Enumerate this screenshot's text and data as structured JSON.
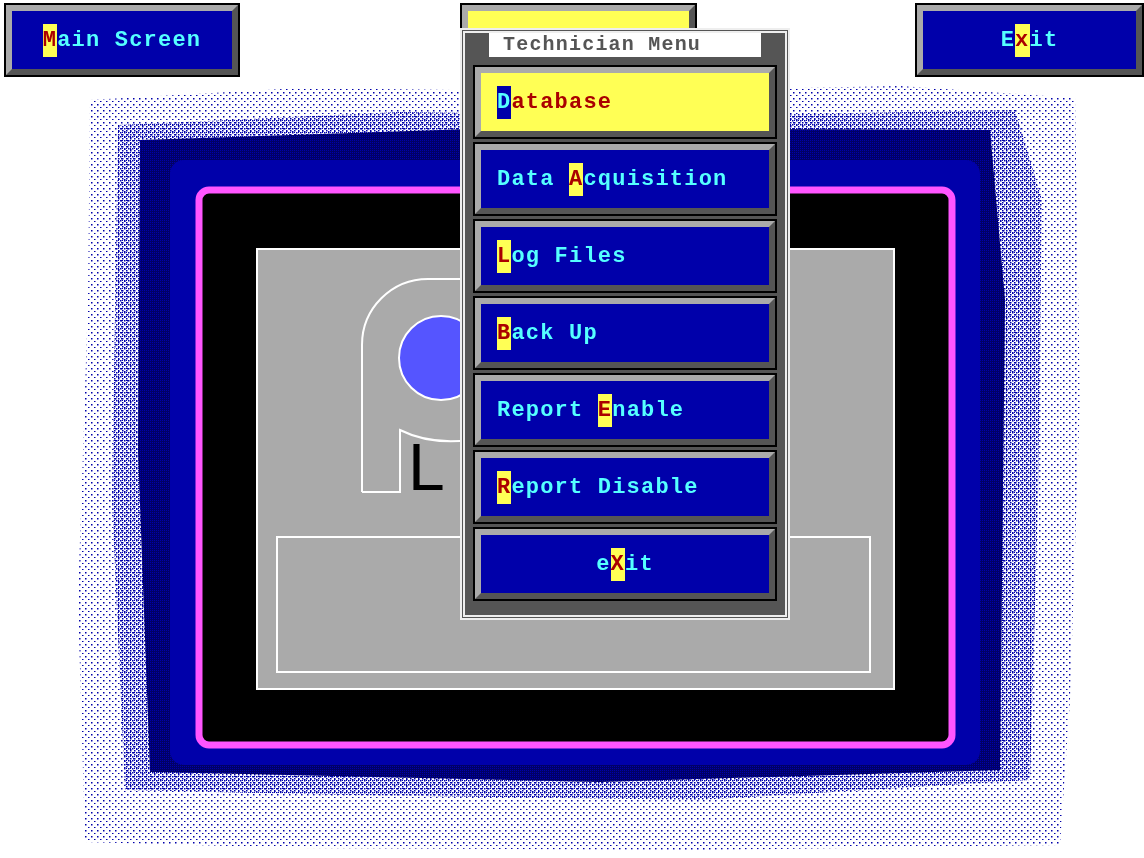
{
  "top_buttons": [
    {
      "hotkey": "M",
      "after": "ain Screen"
    },
    {
      "before": "E",
      "hotkey": "x",
      "after": "it"
    }
  ],
  "logo": {
    "text": "L"
  },
  "menu": {
    "title": "Technician Menu",
    "items": [
      {
        "hotkey": "D",
        "after": "atabase",
        "selected": true,
        "kind": "option"
      },
      {
        "before": "Data ",
        "hotkey": "A",
        "after": "cquisition",
        "selected": false,
        "kind": "option"
      },
      {
        "hotkey": "L",
        "after": "og Files",
        "selected": false,
        "kind": "option"
      },
      {
        "hotkey": "B",
        "after": "ack Up",
        "selected": false,
        "kind": "option"
      },
      {
        "before": "Report ",
        "hotkey": "E",
        "after": "nable",
        "selected": false,
        "kind": "option"
      },
      {
        "hotkey": "R",
        "after": "eport Disable",
        "selected": false,
        "kind": "option"
      },
      {
        "before": "e",
        "hotkey": "X",
        "after": "it",
        "selected": false,
        "kind": "exit"
      }
    ]
  }
}
